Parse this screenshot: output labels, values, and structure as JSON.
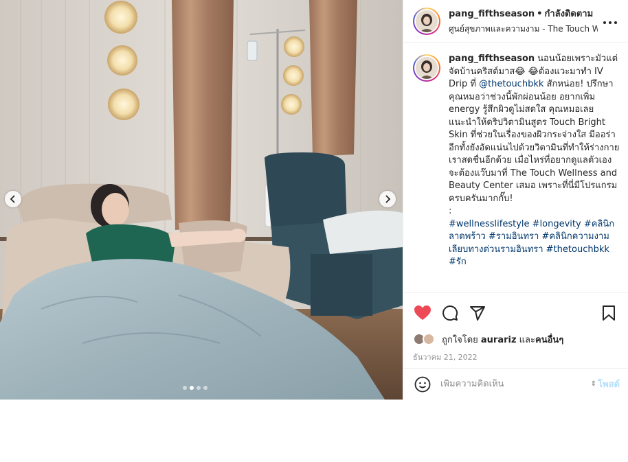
{
  "header": {
    "username": "pang_fifthseason",
    "separator": "•",
    "follow_label": "กำลังติดตาม",
    "location": "ศูนย์สุขภาพและความงาม - The Touch Wellness and Beauty Center",
    "more_icon": "more-horizontal-icon"
  },
  "caption": {
    "username": "pang_fifthseason",
    "text_1": "นอนน้อยเพราะมัวแต่จัดบ้านคริสต์มาส😂 😂ต้องแวะมาทำ IV Drip ที่ ",
    "mention": "@thetouchbkk",
    "text_2": " สักหน่อย! ปรึกษาคุณหมอว่าช่วงนี้พักผ่อนน้อย อยากเพิ่ม energy รู้สึกผิวดูไม่สดใส คุณหมอเลยแนะนำให้ดริปวิตามินสูตร Touch Bright Skin ที่ช่วยในเรื่องของผิวกระจ่างใส มีออร่า อีกทั้งยังอัดแน่นไปด้วยวิตามินที่ทำให้ร่างกายเราสดชื่นอีกด้วย เมื่อไหร่ที่อยากดูแลตัวเองจะต้องแว๊บมาที่ The Touch Wellness and Beauty Center เสมอ เพราะที่นี่มีโปรแกรมครบครันมากกั๊บ!",
    "colon": ":",
    "hashtags": [
      "#wellnesslifestyle",
      "#longevity",
      "#คลินิกลาดพร้าว",
      "#รามอินทรา",
      "#คลินิกความงามเลียบทางด่วนรามอินทรา",
      "#thetouchbkk",
      "#รัก"
    ]
  },
  "actions": {
    "like_icon": "heart-filled-icon",
    "comment_icon": "comment-icon",
    "share_icon": "paper-plane-icon",
    "save_icon": "bookmark-icon",
    "liked_by_prefix": "ถูกใจโดย ",
    "liked_by_user": "aurariz",
    "liked_by_and": " และ",
    "liked_by_others": "คนอื่นๆ",
    "date": "ธันวาคม 21, 2022"
  },
  "comment_box": {
    "emoji_icon": "smiley-icon",
    "placeholder": "เพิ่มความคิดเห็น",
    "post_label": "โพสต์"
  },
  "carousel": {
    "total_slides": 4,
    "active_slide": 2,
    "prev_icon": "chevron-left-icon",
    "next_icon": "chevron-right-icon"
  },
  "colors": {
    "like_red": "#ed4956",
    "link_blue": "#00376b",
    "post_button_disabled": "#b2dffc",
    "muted_gray": "#8e8e8e",
    "border": "#efefef"
  }
}
